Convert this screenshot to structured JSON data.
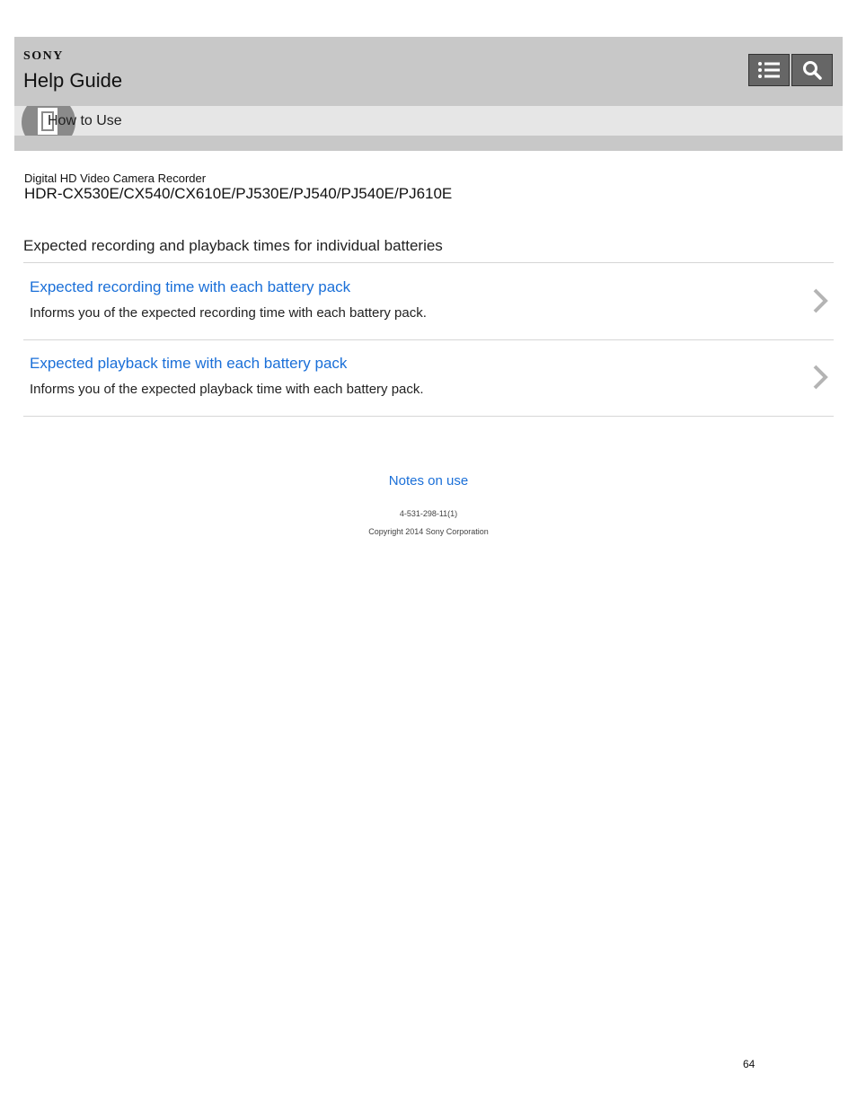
{
  "header": {
    "brand": "SONY",
    "title": "Help Guide",
    "menu_icon": "list-icon",
    "search_icon": "search-icon",
    "breadcrumb_icon": "book-icon",
    "breadcrumb": "How to Use"
  },
  "product": {
    "category": "Digital HD Video Camera Recorder",
    "models": "HDR-CX530E/CX540/CX610E/PJ530E/PJ540/PJ540E/PJ610E"
  },
  "page": {
    "heading": "Expected recording and playback times for individual batteries",
    "items": [
      {
        "title": "Expected recording time with each battery pack",
        "description": "Informs you of the expected recording time with each battery pack."
      },
      {
        "title": "Expected playback time with each battery pack",
        "description": "Informs you of the expected playback time with each battery pack."
      }
    ]
  },
  "footer": {
    "notes_link": "Notes on use",
    "doc_id": "4-531-298-11(1)",
    "copyright": "Copyright 2014 Sony Corporation",
    "page_number": "64"
  },
  "colors": {
    "link": "#1a6fd8",
    "header_bg": "#c8c8c8",
    "subbar_bg": "#e6e6e6"
  }
}
